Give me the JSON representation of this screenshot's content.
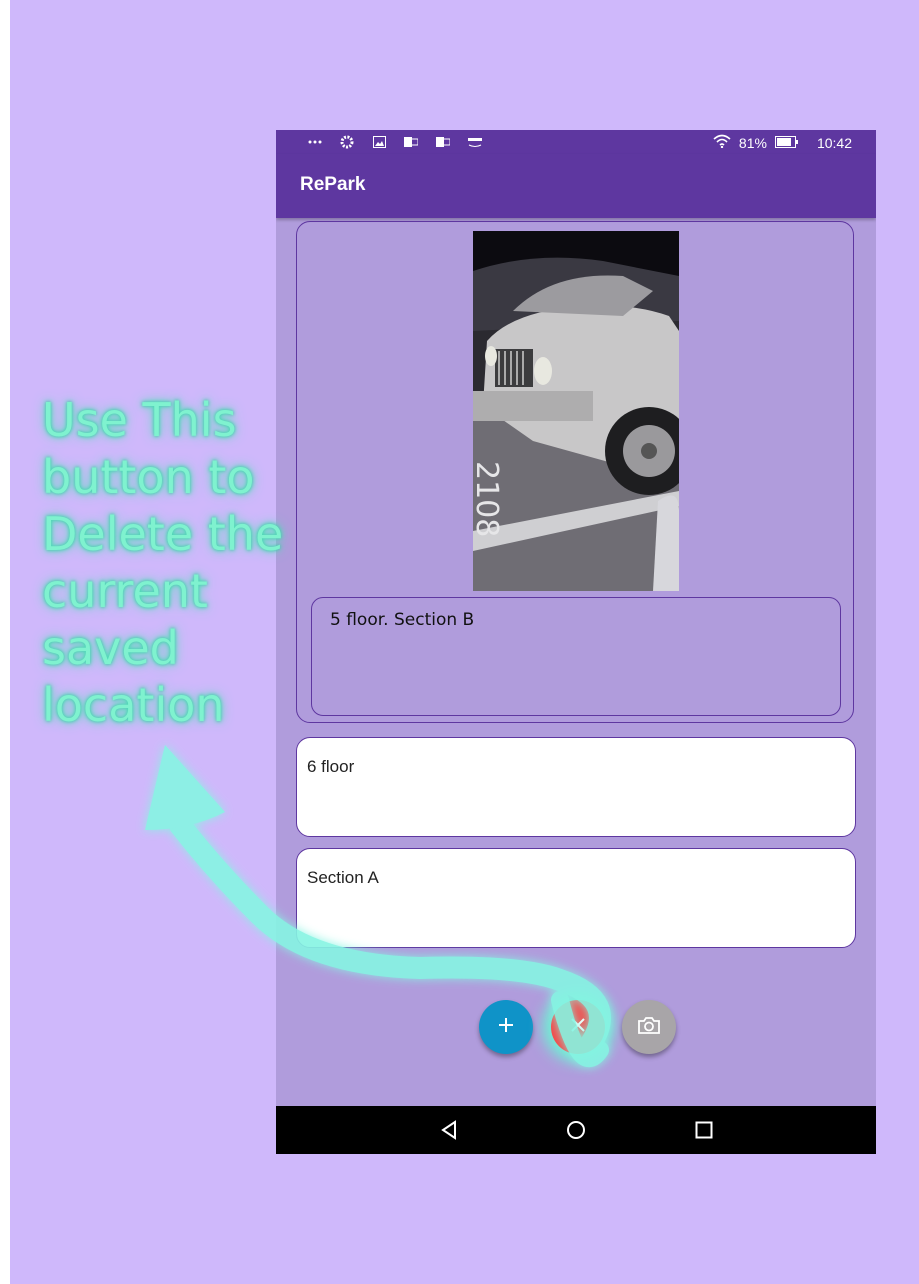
{
  "app": {
    "title": "RePark"
  },
  "status_bar": {
    "left_icons": [
      "more-icon",
      "gear-icon",
      "image-icon",
      "outlook-icon",
      "outlook-icon",
      "amazon-icon"
    ],
    "wifi_icon": "wifi-icon",
    "battery_percent": "81%",
    "battery_icon": "battery-icon",
    "time": "10:42"
  },
  "saved_location": {
    "photo_icon": "car-photo",
    "note": "5 floor. Section B"
  },
  "inputs": {
    "floor_value": "6 floor",
    "section_value": "Section A"
  },
  "actions": {
    "add_icon": "plus-icon",
    "delete_icon": "close-icon",
    "camera_icon": "camera-icon",
    "colors": {
      "add": "#0f93c8",
      "delete": "#f54848",
      "camera": "#a8a5a8"
    }
  },
  "nav": {
    "back_icon": "back-icon",
    "home_icon": "home-icon",
    "recents_icon": "recents-icon"
  },
  "annotation": {
    "lines": [
      "Use This",
      "button to",
      "Delete the",
      "current",
      "saved",
      "location"
    ],
    "color": "#7ff2cf"
  },
  "colors": {
    "background": "#cfb8fb",
    "app_bar": "#5e37a0",
    "content": "#b09cdc"
  }
}
